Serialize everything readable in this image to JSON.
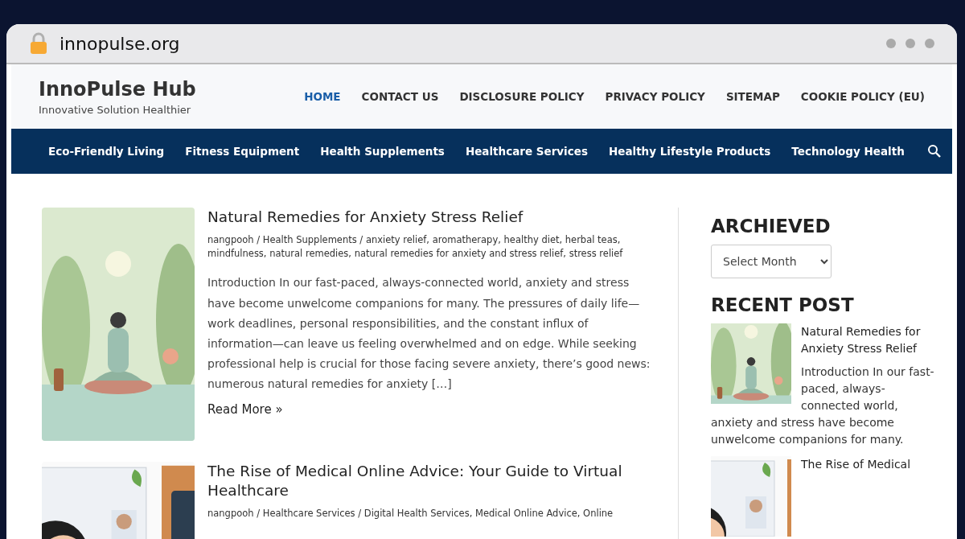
{
  "browser": {
    "url": "innopulse.org"
  },
  "site": {
    "title": "InnoPulse Hub",
    "tagline": "Innovative Solution Healthier"
  },
  "top_menu": [
    {
      "label": "HOME",
      "selected": true
    },
    {
      "label": "CONTACT US",
      "selected": false
    },
    {
      "label": "DISCLOSURE POLICY",
      "selected": false
    },
    {
      "label": "PRIVACY POLICY",
      "selected": false
    },
    {
      "label": "SITEMAP",
      "selected": false
    },
    {
      "label": "COOKIE POLICY (EU)",
      "selected": false
    }
  ],
  "category_menu": [
    "Eco-Friendly Living",
    "Fitness Equipment",
    "Health Supplements",
    "Healthcare Services",
    "Healthy Lifestyle Products",
    "Technology Health"
  ],
  "posts": [
    {
      "title": "Natural Remedies for Anxiety Stress Relief",
      "meta": "nangpooh / Health Supplements / anxiety relief, aromatherapy, healthy diet, herbal teas, mindfulness, natural remedies, natural remedies for anxiety and stress relief, stress relief",
      "excerpt": "Introduction In our fast-paced, always-connected world, anxiety and stress have become unwelcome companions for many. The pressures of daily life—work deadlines, personal responsibilities, and the constant influx of information—can leave us feeling overwhelmed and on edge. While seeking professional help is crucial for those facing severe anxiety, there’s good news: numerous natural remedies for anxiety […]",
      "read_more": "Read More »"
    },
    {
      "title": "The Rise of Medical Online Advice: Your Guide to Virtual Healthcare",
      "meta": "nangpooh / Healthcare Services / Digital Health Services, Medical Online Advice, Online"
    }
  ],
  "sidebar": {
    "archive_heading": "ARCHIEVED",
    "archive_select": "Select Month",
    "recent_heading": "RECENT POST",
    "recent": [
      {
        "title": "Natural Remedies for Anxiety Stress Relief",
        "excerpt": "Introduction In our fast-paced, always-connected world, anxiety and stress have become unwelcome companions for many."
      },
      {
        "title": "The Rise of Medical"
      }
    ]
  }
}
